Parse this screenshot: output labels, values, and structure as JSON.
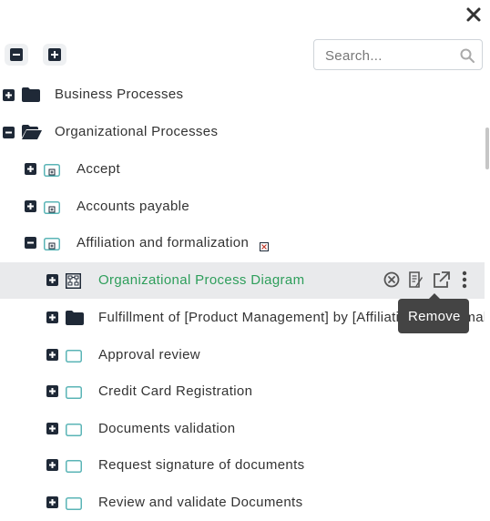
{
  "search": {
    "placeholder": "Search..."
  },
  "tree": [
    {
      "label": "Business Processes"
    },
    {
      "label": "Organizational Processes"
    },
    {
      "label": "Accept"
    },
    {
      "label": "Accounts payable"
    },
    {
      "label": "Affiliation and formalization"
    },
    {
      "label": "Organizational Process Diagram"
    },
    {
      "label": "Fulfillment of [Product Management] by [Affiliation and formalization]"
    },
    {
      "label": "Approval review"
    },
    {
      "label": "Credit Card Registration"
    },
    {
      "label": "Documents validation"
    },
    {
      "label": "Request signature of documents"
    },
    {
      "label": "Review and validate Documents"
    }
  ],
  "tooltip": {
    "text": "Remove"
  },
  "colors": {
    "selected_label": "#2e9e5b",
    "selected_row": "#e9eaec",
    "folder_icon": "#1f2937",
    "diagram_icon": "#5ab4b6"
  }
}
